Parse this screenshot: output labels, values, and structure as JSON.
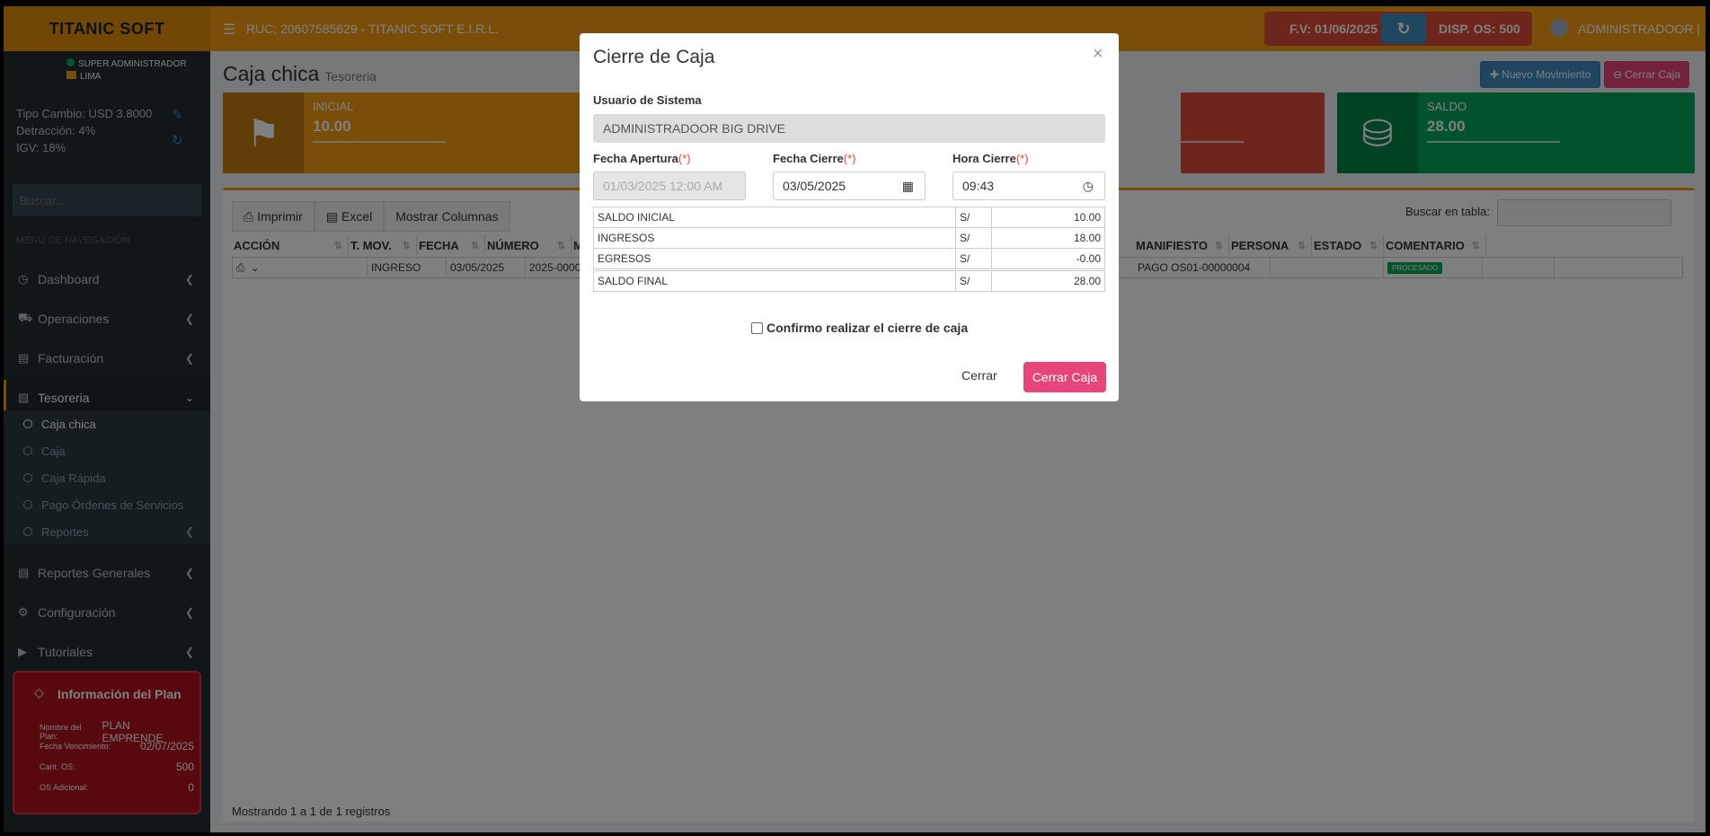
{
  "header": {
    "brand": "TITANIC SOFT",
    "ruc": "RUC: 20607585629 - TITANIC SOFT E.I.R.L.",
    "fv": "F.V: 01/06/2025",
    "disp_os": "DISP. OS: 500",
    "user": "ADMINISTRADOOR |"
  },
  "sidebar": {
    "role": "SUPER ADMINISTRADOR",
    "location": "LIMA",
    "tipo_cambio": "Tipo Cambio: USD 3.8000",
    "detraccion": "Detracción: 4%",
    "igv": "IGV: 18%",
    "search_placeholder": "Buscar...",
    "nav_header": "MENÚ DE NAVEGACIÓN",
    "items": [
      {
        "label": "Dashboard",
        "icon": "dashboard-icon"
      },
      {
        "label": "Operaciones",
        "icon": "truck-icon"
      },
      {
        "label": "Facturación",
        "icon": "file-icon"
      },
      {
        "label": "Tesoreria",
        "icon": "money-icon"
      },
      {
        "label": "Reportes Generales",
        "icon": "chart-icon"
      },
      {
        "label": "Configuración",
        "icon": "gear-icon"
      },
      {
        "label": "Tutoriales",
        "icon": "play-icon"
      }
    ],
    "subitems": [
      "Caja chica",
      "Caja",
      "Caja Rápida",
      "Pago Órdenes de Servicios",
      "Reportes"
    ],
    "plan": {
      "title": "Información del Plan",
      "nombre_label": "Nombre del Plan:",
      "nombre_value": "PLAN EMPRENDE",
      "venc_label": "Fecha Vencimiento:",
      "venc_value": "02/07/2025",
      "cant_label": "Cant. OS:",
      "cant_value": "500",
      "adic_label": "OS Adicional:",
      "adic_value": "0"
    }
  },
  "page": {
    "title": "Caja chica",
    "subtitle": "Tesoreria",
    "btn_nuevo": "Nuevo Movimiento",
    "btn_cerrar": "Cerrar Caja",
    "inicial_label": "INICIAL",
    "inicial_value": "10.00",
    "saldo_label": "SALDO",
    "saldo_value": "28.00",
    "btn_imprimir": "Imprimir",
    "btn_excel": "Excel",
    "btn_columnas": "Mostrar Columnas",
    "search_label": "Buscar en tabla:",
    "columns_left": [
      "ACCIÓN",
      "T. MOV.",
      "FECHA",
      "NÚMERO",
      "M"
    ],
    "columns_right": [
      "MANIFIESTO",
      "PERSONA",
      "ESTADO",
      "COMENTARIO"
    ],
    "row": {
      "tmov": "INGRESO",
      "fecha": "03/05/2025",
      "numero": "2025-0000",
      "manifiesto": "PAGO OS01-00000004",
      "estado": "PROCESADO"
    },
    "footer": "Mostrando 1 a 1 de 1 registros"
  },
  "modal": {
    "title": "Cierre de Caja",
    "close_glyph": "×",
    "usuario_label": "Usuario de Sistema",
    "usuario_value": "ADMINISTRADOOR  BIG DRIVE",
    "apertura_label": "Fecha Apertura",
    "apertura_value": "01/03/2025 12:00 AM",
    "cierre_label": "Fecha Cierre",
    "cierre_value": "03/05/2025",
    "hora_label": "Hora Cierre",
    "hora_value": "09:43",
    "required_mark": "(*)",
    "summary": [
      {
        "label": "SALDO INICIAL",
        "cur": "S/",
        "value": "10.00"
      },
      {
        "label": "INGRESOS",
        "cur": "S/",
        "value": "18.00"
      },
      {
        "label": "EGRESOS",
        "cur": "S/",
        "value": "-0.00"
      }
    ],
    "final": {
      "label": "SALDO FINAL",
      "cur": "S/",
      "value": "28.00"
    },
    "confirm_label": "Confirmo realizar el cierre de caja",
    "btn_close": "Cerrar",
    "btn_submit": "Cerrar Caja"
  }
}
